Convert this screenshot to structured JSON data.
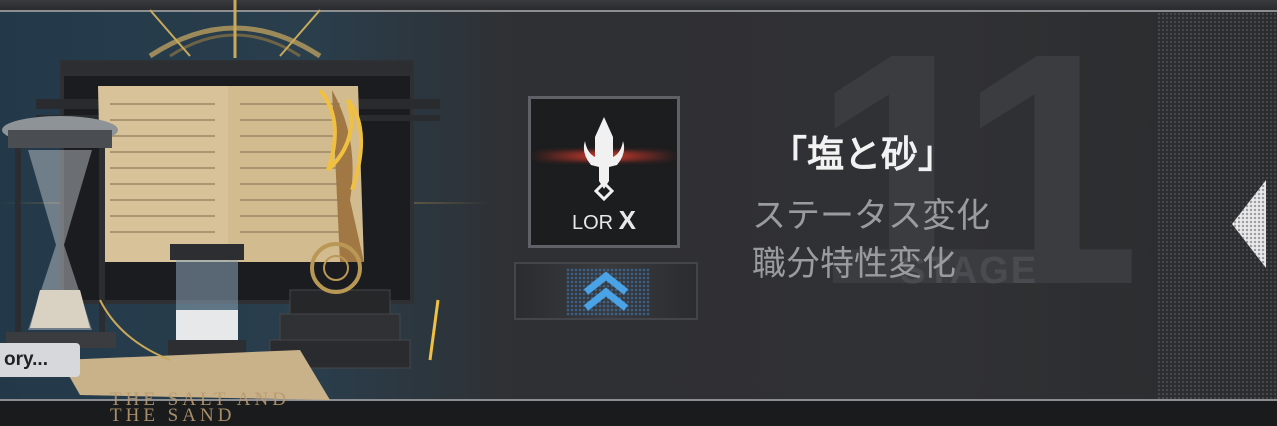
{
  "story_tag": "ory...",
  "artwork_caption": [
    "THE SALT AND",
    "THE SAND"
  ],
  "background_stage": {
    "number": "11",
    "label": "STAGE"
  },
  "badge": {
    "label_prefix": "LOR",
    "label_suffix": "X",
    "icon": "trident-icon"
  },
  "rank": {
    "icon": "double-chevron-up-icon"
  },
  "title": "「塩と砂」",
  "effects": [
    "ステータス変化",
    "職分特性変化"
  ],
  "colors": {
    "accent_red": "#d33a2a",
    "accent_blue": "#3b86c6",
    "gold": "#c99a45"
  }
}
